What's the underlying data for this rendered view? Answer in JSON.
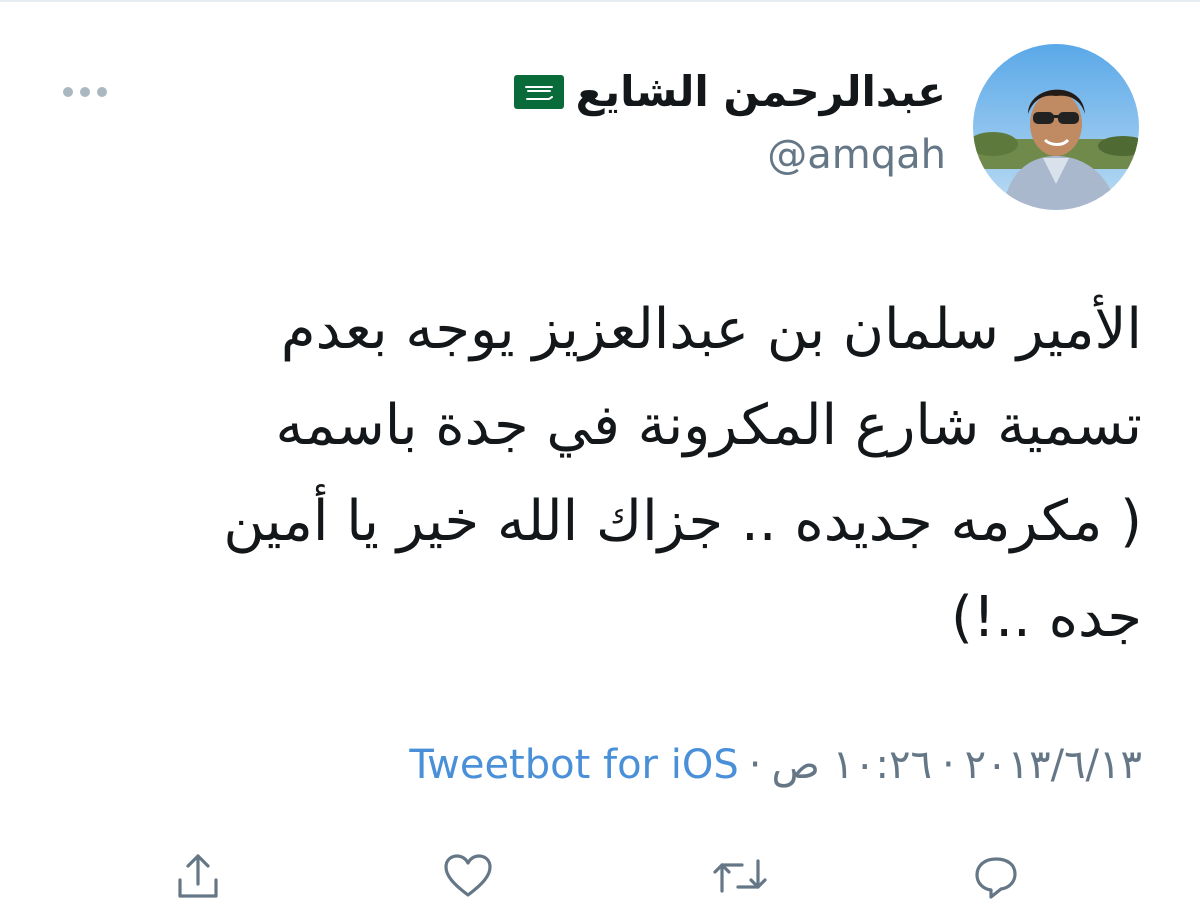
{
  "tweet": {
    "author": {
      "display_name": "عبدالرحمن الشايع",
      "handle": "@amqah",
      "flag_icon": "saudi-flag-icon"
    },
    "text": "الأمير سلمان بن عبدالعزيز يوجه بعدم\nتسمية شارع المكرونة في جدة باسمه\n( مكرمه جديده .. جزاك الله خير يا أمين\nجده ..!)",
    "meta": {
      "date": "٢٠١٣/٦/١٣",
      "separator": "·",
      "time": "١٠:٢٦ ص",
      "source": "Tweetbot for iOS"
    }
  },
  "icons": {
    "more": "more-dots-icon",
    "reply": "reply-icon",
    "retweet": "retweet-icon",
    "like": "heart-icon",
    "share": "share-icon"
  },
  "colors": {
    "text": "#14171a",
    "secondary": "#657786",
    "link": "#4a90d9",
    "icon": "#657786"
  }
}
